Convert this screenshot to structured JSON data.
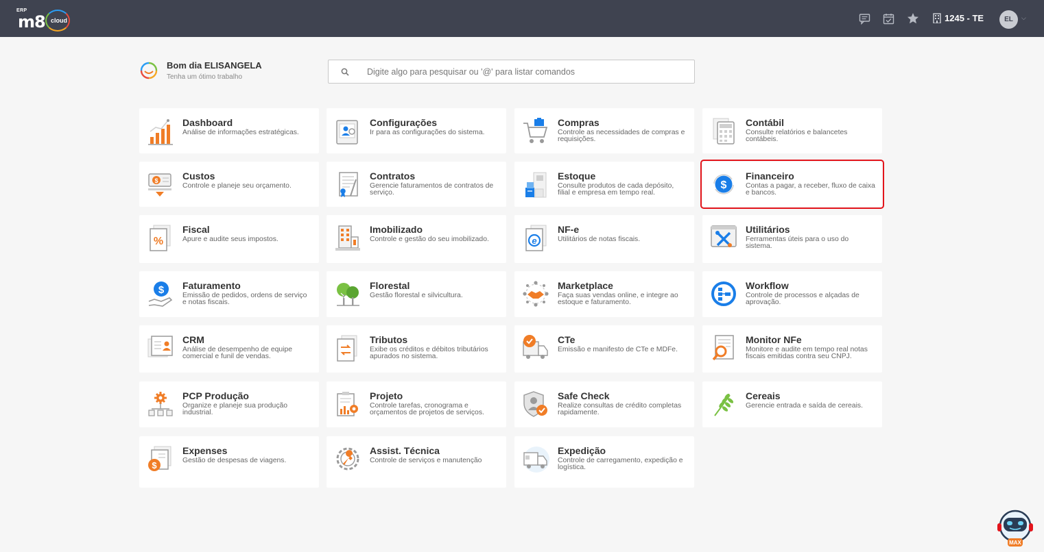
{
  "header": {
    "logo_top": "ERP",
    "logo_main": "m8",
    "logo_sub": "cloud",
    "company": "1245 - TE",
    "avatar_initials": "EL"
  },
  "greeting": {
    "title": "Bom dia ELISANGELA",
    "subtitle": "Tenha um ótimo trabalho"
  },
  "search": {
    "placeholder": "Digite algo para pesquisar ou '@' para listar comandos"
  },
  "modules": [
    {
      "title": "Dashboard",
      "desc": "Análise de informações estratégicas.",
      "icon": "bar-chart-icon"
    },
    {
      "title": "Configurações",
      "desc": "Ir para as configurações do sistema.",
      "icon": "settings-user-icon"
    },
    {
      "title": "Compras",
      "desc": "Controle as necessidades de compras e requisições.",
      "icon": "shopping-cart-icon"
    },
    {
      "title": "Contábil",
      "desc": "Consulte relatórios e balancetes contábeis.",
      "icon": "calculator-icon"
    },
    {
      "title": "Custos",
      "desc": "Controle e planeje seu orçamento.",
      "icon": "cost-icon"
    },
    {
      "title": "Contratos",
      "desc": "Gerencie faturamentos de contratos de serviço.",
      "icon": "contract-icon"
    },
    {
      "title": "Estoque",
      "desc": "Consulte produtos de cada depósito, filial e empresa em tempo real.",
      "icon": "warehouse-icon"
    },
    {
      "title": "Financeiro",
      "desc": "Contas a pagar, a receber, fluxo de caixa e bancos.",
      "icon": "dollar-cycle-icon"
    },
    {
      "title": "Fiscal",
      "desc": "Apure e audite seus impostos.",
      "icon": "percent-doc-icon"
    },
    {
      "title": "Imobilizado",
      "desc": "Controle e gestão do seu imobilizado.",
      "icon": "building-icon"
    },
    {
      "title": "NF-e",
      "desc": "Utilitários de notas fiscais.",
      "icon": "nfe-doc-icon"
    },
    {
      "title": "Utilitários",
      "desc": "Ferramentas úteis para o uso do sistema.",
      "icon": "tools-icon"
    },
    {
      "title": "Faturamento",
      "desc": "Emissão de pedidos, ordens de serviço e notas fiscais.",
      "icon": "hand-dollar-icon"
    },
    {
      "title": "Florestal",
      "desc": "Gestão florestal e silvicultura.",
      "icon": "trees-icon"
    },
    {
      "title": "Marketplace",
      "desc": "Faça suas vendas online, e integre ao estoque e faturamento.",
      "icon": "handshake-icon"
    },
    {
      "title": "Workflow",
      "desc": "Controle de processos e alçadas de aprovação.",
      "icon": "workflow-icon"
    },
    {
      "title": "CRM",
      "desc": "Análise de desempenho de equipe comercial e funil de vendas.",
      "icon": "contact-card-icon"
    },
    {
      "title": "Tributos",
      "desc": "Exibe os créditos e débitos tributários apurados no sistema.",
      "icon": "exchange-doc-icon"
    },
    {
      "title": "CTe",
      "desc": "Emissão e manifesto de CTe e MDFe.",
      "icon": "truck-check-icon"
    },
    {
      "title": "Monitor NFe",
      "desc": "Monitore e audite em tempo real notas fiscais emitidas contra seu CNPJ.",
      "icon": "magnifier-doc-icon"
    },
    {
      "title": "PCP Produção",
      "desc": "Organize e planeje sua produção industrial.",
      "icon": "production-gear-icon"
    },
    {
      "title": "Projeto",
      "desc": "Controle tarefas, cronograma e orçamentos de projetos de serviços.",
      "icon": "project-clipboard-icon"
    },
    {
      "title": "Safe Check",
      "desc": "Realize consultas de crédito completas rapidamente.",
      "icon": "shield-check-icon"
    },
    {
      "title": "Cereais",
      "desc": "Gerencie entrada e saída de cereais.",
      "icon": "wheat-icon"
    },
    {
      "title": "Expenses",
      "desc": "Gestão de despesas de viagens.",
      "icon": "expense-receipt-icon"
    },
    {
      "title": "Assist. Técnica",
      "desc": "Controle de serviços e manutenção",
      "icon": "wrench-gear-icon"
    },
    {
      "title": "Expedição",
      "desc": "Controle de carregamento, expedição e logística.",
      "icon": "delivery-truck-icon"
    }
  ],
  "highlighted_module": "Financeiro",
  "assistant": {
    "label": "MAX"
  },
  "colors": {
    "topbar": "#3f4350",
    "accent_orange": "#f07d27",
    "accent_blue": "#1a7ee8",
    "highlight": "#e3141b"
  }
}
